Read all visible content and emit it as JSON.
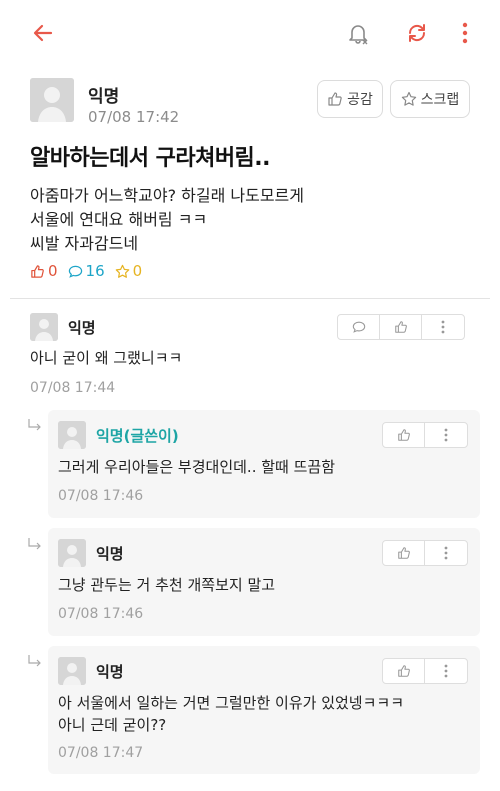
{
  "colors": {
    "accent": "#e8584a",
    "op": "#1ea5a5",
    "like": "#e0533a",
    "comment": "#1ea5c8",
    "scrap": "#e6b422"
  },
  "topbar": {
    "icons": [
      "back-arrow-icon",
      "bell-off-icon",
      "refresh-icon",
      "more-vertical-icon"
    ]
  },
  "post": {
    "author": "익명",
    "date": "07/08 17:42",
    "empathize_label": "공감",
    "scrap_label": "스크랩",
    "title": "알바하는데서 구라쳐버림..",
    "body_lines": [
      "아줌마가 어느학교야? 하길래 나도모르게",
      "서울에 연대요 해버림 ㅋㅋ",
      "씨발 자과감드네"
    ],
    "likes": "0",
    "comments": "16",
    "scraps": "0"
  },
  "comments": [
    {
      "author": "익명",
      "text": [
        "아니 굳이 왜 그랬니ㅋㅋ"
      ],
      "date": "07/08 17:44"
    },
    {
      "author": "익명(글쓴이)",
      "text": [
        "그러게 우리아들은 부경대인데.. 할때 뜨끔함"
      ],
      "date": "07/08 17:46"
    },
    {
      "author": "익명",
      "text": [
        "그냥 관두는 거 추천 개쪽보지 말고"
      ],
      "date": "07/08 17:46"
    },
    {
      "author": "익명",
      "text": [
        "아 서울에서 일하는 거면 그럴만한 이유가 있었넹ㅋㅋㅋ",
        "아니 근데 굳이??"
      ],
      "date": "07/08 17:47"
    }
  ]
}
